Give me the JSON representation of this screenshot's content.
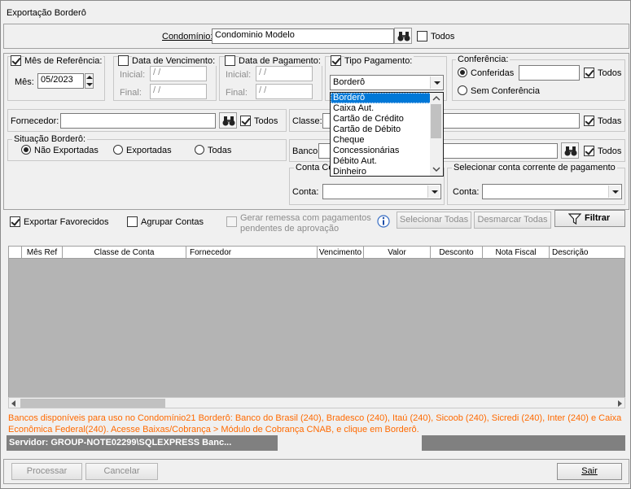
{
  "window": {
    "title": "Exportação Borderô"
  },
  "condominio": {
    "label": "Condomínio:",
    "value": "Condominio Modelo",
    "todos_label": "Todos"
  },
  "mes_ref": {
    "label": "Mês de Referência:",
    "mes_label": "Mês:",
    "value": "05/2023"
  },
  "data_venc": {
    "label": "Data de Vencimento:",
    "inicial_label": "Inicial:",
    "final_label": "Final:",
    "inicial_value": " / /",
    "final_value": " / /"
  },
  "data_pag": {
    "label": "Data de Pagamento:",
    "inicial_label": "Inicial:",
    "final_label": "Final:",
    "inicial_value": " / /",
    "final_value": " / /"
  },
  "tipo_pag": {
    "label": "Tipo Pagamento:",
    "selected": "Borderô",
    "options": [
      "Borderô",
      "Caixa Aut.",
      "Cartão de Crédito",
      "Cartão de Débito",
      "Cheque",
      "Concessionárias",
      "Débito Aut.",
      "Dinheiro"
    ]
  },
  "conferencia": {
    "label": "Conferência:",
    "conferidas_label": "Conferidas",
    "todos_label": "Todos",
    "sem_label": "Sem Conferência"
  },
  "fornecedor": {
    "label": "Fornecedor:",
    "todos_label": "Todos"
  },
  "classe": {
    "label": "Classe:",
    "todos_label": "Todas"
  },
  "situacao": {
    "label": "Situação Borderô:",
    "opt1": "Não Exportadas",
    "opt2": "Exportadas",
    "opt3": "Todas"
  },
  "banco": {
    "label": "Banco:",
    "todos_label": "Todos"
  },
  "conta_co": {
    "label": "Conta Co",
    "conta_label": "Conta:"
  },
  "conta_pag": {
    "label": "Selecionar conta corrente de pagamento",
    "conta_label": "Conta:"
  },
  "options": {
    "exportar_fav": "Exportar Favorecidos",
    "agrupar": "Agrupar Contas",
    "gerar_remessa_1": "Gerar remessa com pagamentos",
    "gerar_remessa_2": "pendentes de aprovação"
  },
  "buttons": {
    "selecionar": "Selecionar Todas",
    "desmarcar": "Desmarcar Todas",
    "filtrar": "Filtrar",
    "processar": "Processar",
    "cancelar": "Cancelar",
    "sair": "Sair"
  },
  "table": {
    "columns": [
      "Mês Ref",
      "Classe de Conta",
      "Fornecedor",
      "Vencimento",
      "Valor",
      "Desconto",
      "Nota Fiscal",
      "Descrição"
    ]
  },
  "note": "Bancos disponíveis para uso no Condomínio21 Borderô: Banco do Brasil (240), Bradesco (240), Itaú (240), Sicoob (240), Sicredi (240), Inter (240) e Caixa Econômica Federal(240). Acesse Baixas/Cobrança > Módulo de Cobrança CNAB, e clique em Borderô.",
  "status": {
    "server": "Servidor: GROUP-NOTE02299\\SQLEXPRESS Banc..."
  },
  "colors": {
    "note": "#ff6a00",
    "selection": "#0078d7",
    "grid_bg": "#b4b4b4"
  }
}
